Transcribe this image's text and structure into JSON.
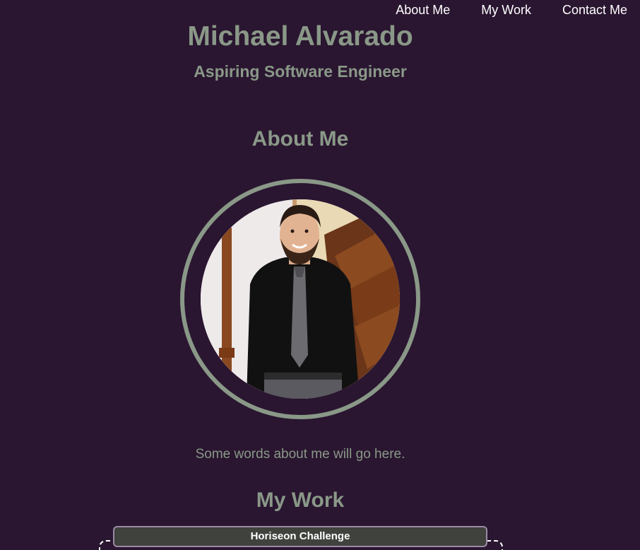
{
  "nav": {
    "items": [
      {
        "label": "About Me"
      },
      {
        "label": "My Work"
      },
      {
        "label": "Contact Me"
      }
    ]
  },
  "header": {
    "name": "Michael Alvarado",
    "tagline": "Aspiring Software Engineer"
  },
  "about": {
    "title": "About Me",
    "text": "Some words about me will go here."
  },
  "work": {
    "title": "My Work",
    "projects": [
      {
        "label": "Horiseon Challenge"
      }
    ]
  },
  "colors": {
    "background": "#2a1630",
    "accent": "#8a9888",
    "nav_text": "#ffffff",
    "card_bg": "#3f423d",
    "card_border": "#9b8aa4"
  }
}
